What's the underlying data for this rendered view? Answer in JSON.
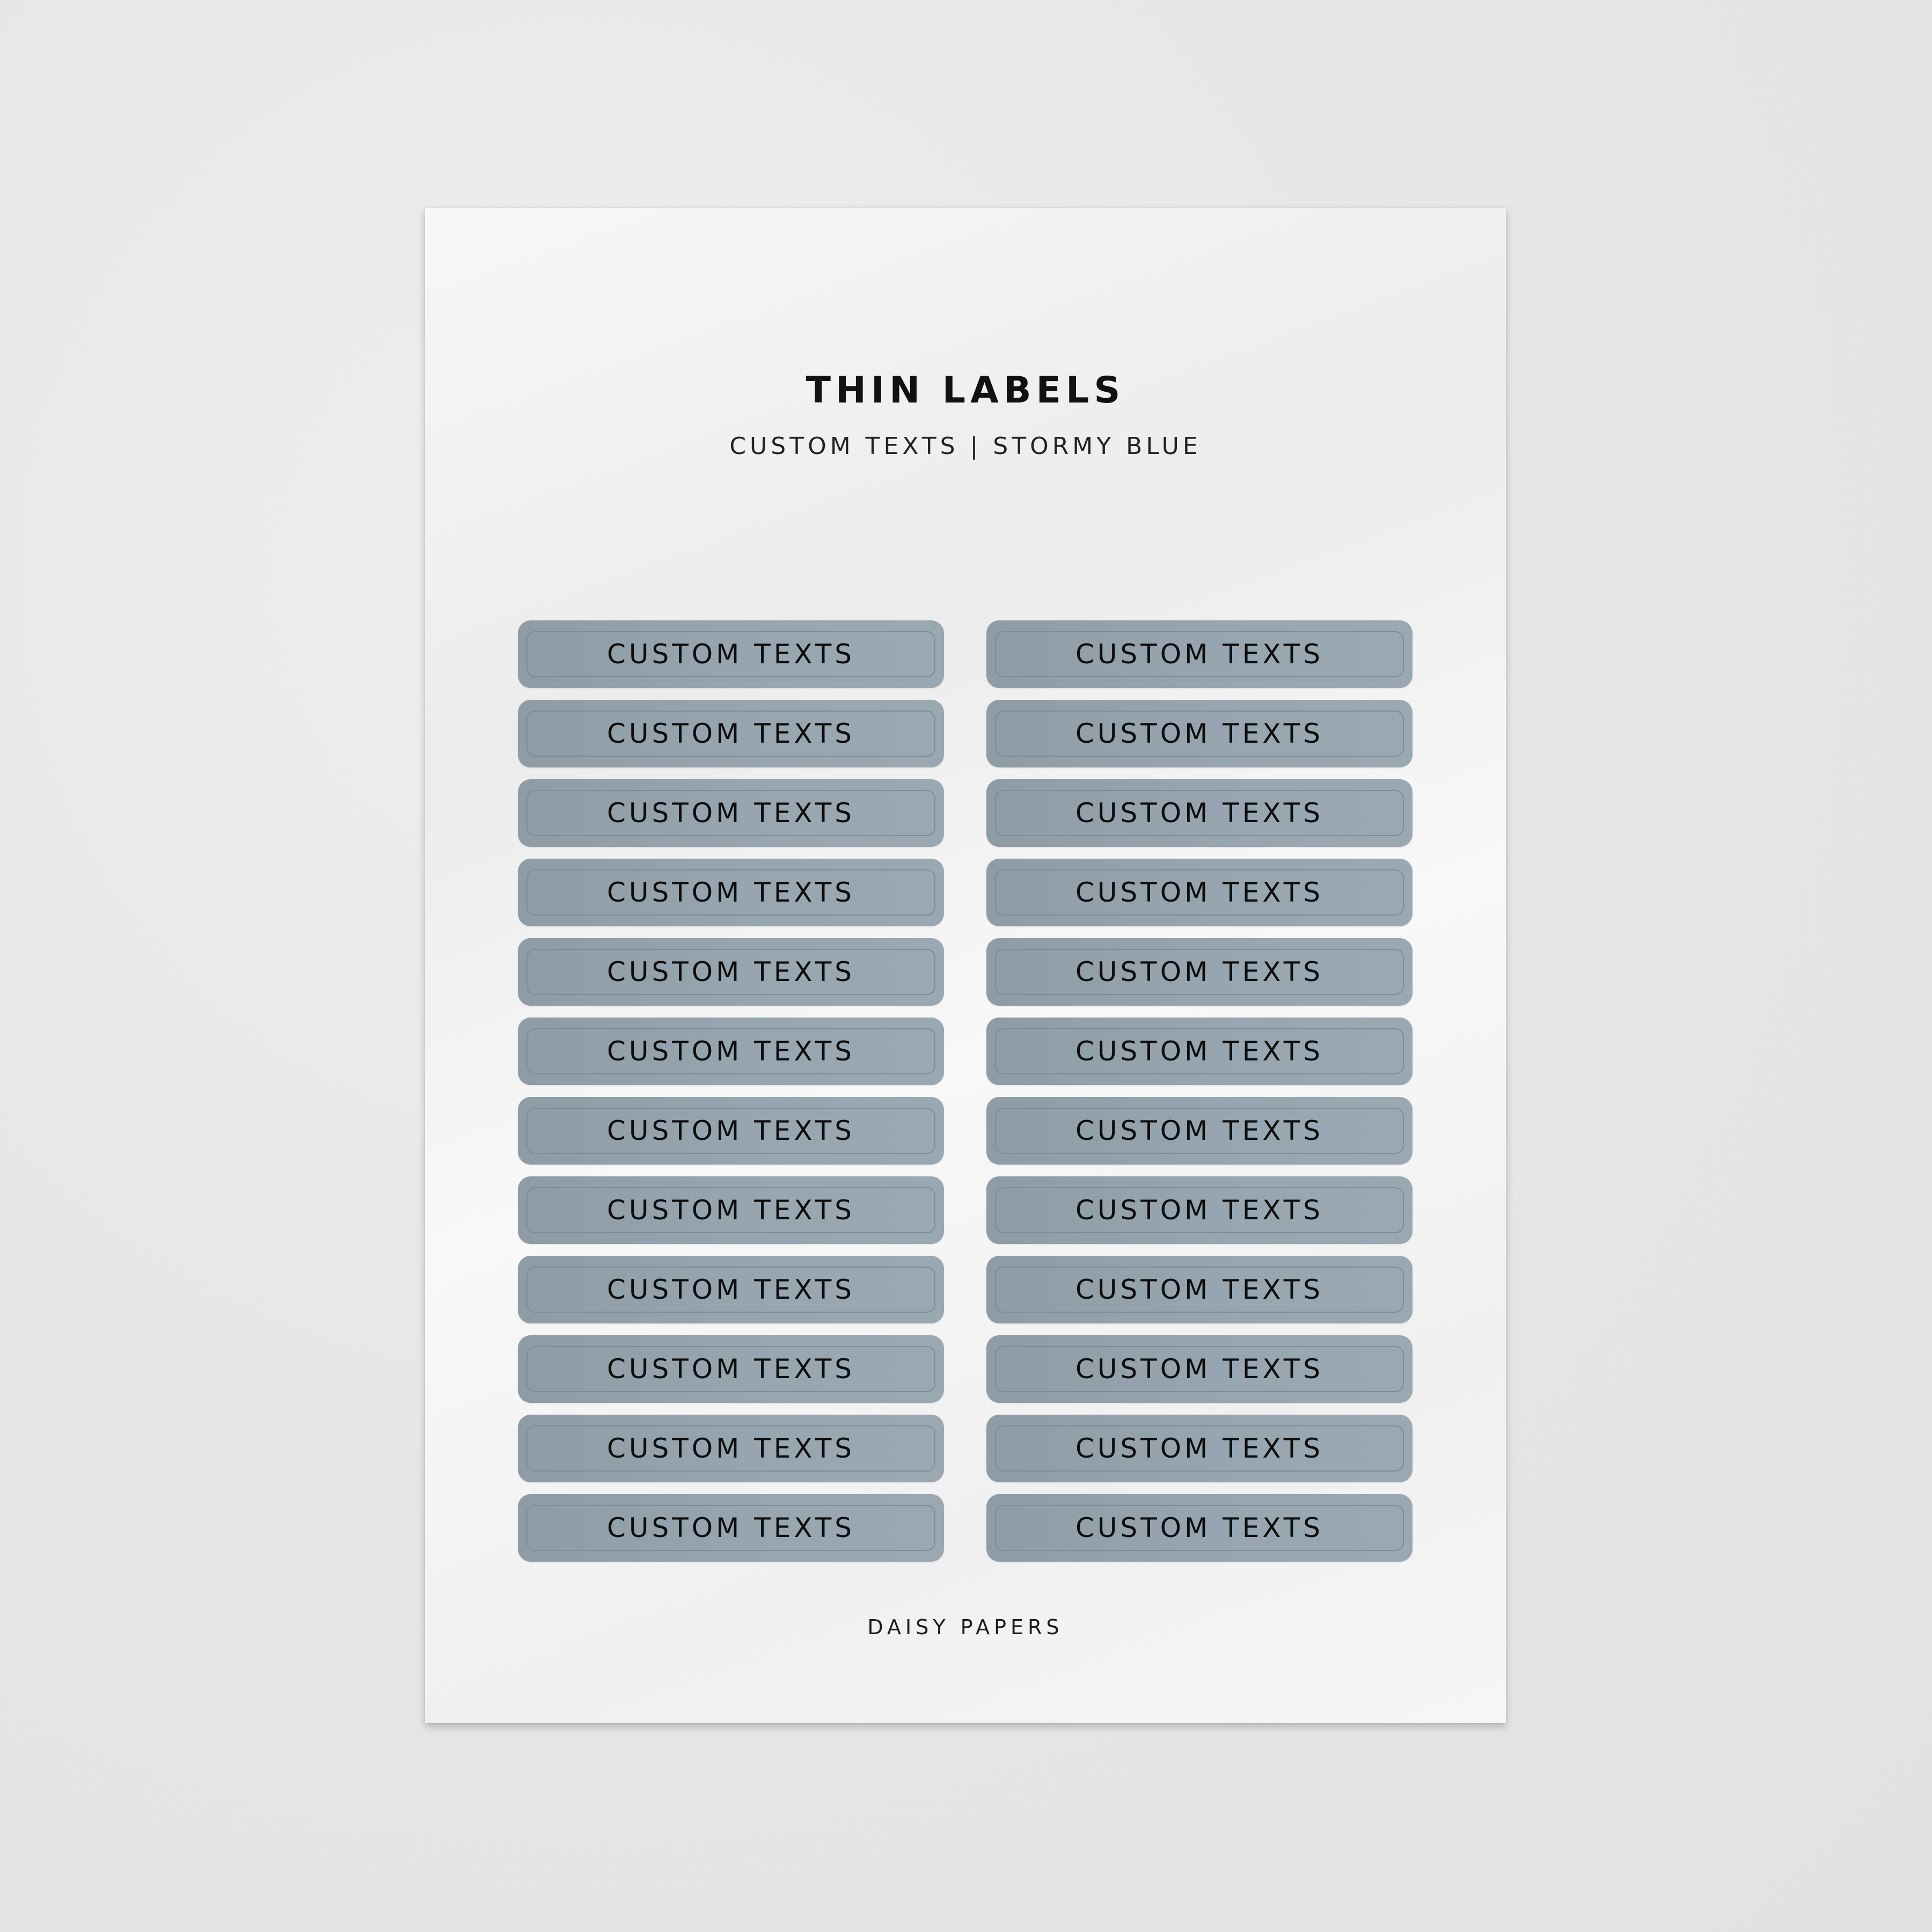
{
  "sheet": {
    "title": "THIN LABELS",
    "subtitle": "CUSTOM TEXTS  |  STORMY BLUE",
    "brand": "DAISY PAPERS",
    "label_color": "#95a3ad",
    "columns": [
      {
        "labels": [
          "CUSTOM TEXTS",
          "CUSTOM TEXTS",
          "CUSTOM TEXTS",
          "CUSTOM TEXTS",
          "CUSTOM TEXTS",
          "CUSTOM TEXTS",
          "CUSTOM TEXTS",
          "CUSTOM TEXTS",
          "CUSTOM TEXTS",
          "CUSTOM TEXTS",
          "CUSTOM TEXTS",
          "CUSTOM TEXTS"
        ]
      },
      {
        "labels": [
          "CUSTOM TEXTS",
          "CUSTOM TEXTS",
          "CUSTOM TEXTS",
          "CUSTOM TEXTS",
          "CUSTOM TEXTS",
          "CUSTOM TEXTS",
          "CUSTOM TEXTS",
          "CUSTOM TEXTS",
          "CUSTOM TEXTS",
          "CUSTOM TEXTS",
          "CUSTOM TEXTS",
          "CUSTOM TEXTS"
        ]
      }
    ]
  }
}
